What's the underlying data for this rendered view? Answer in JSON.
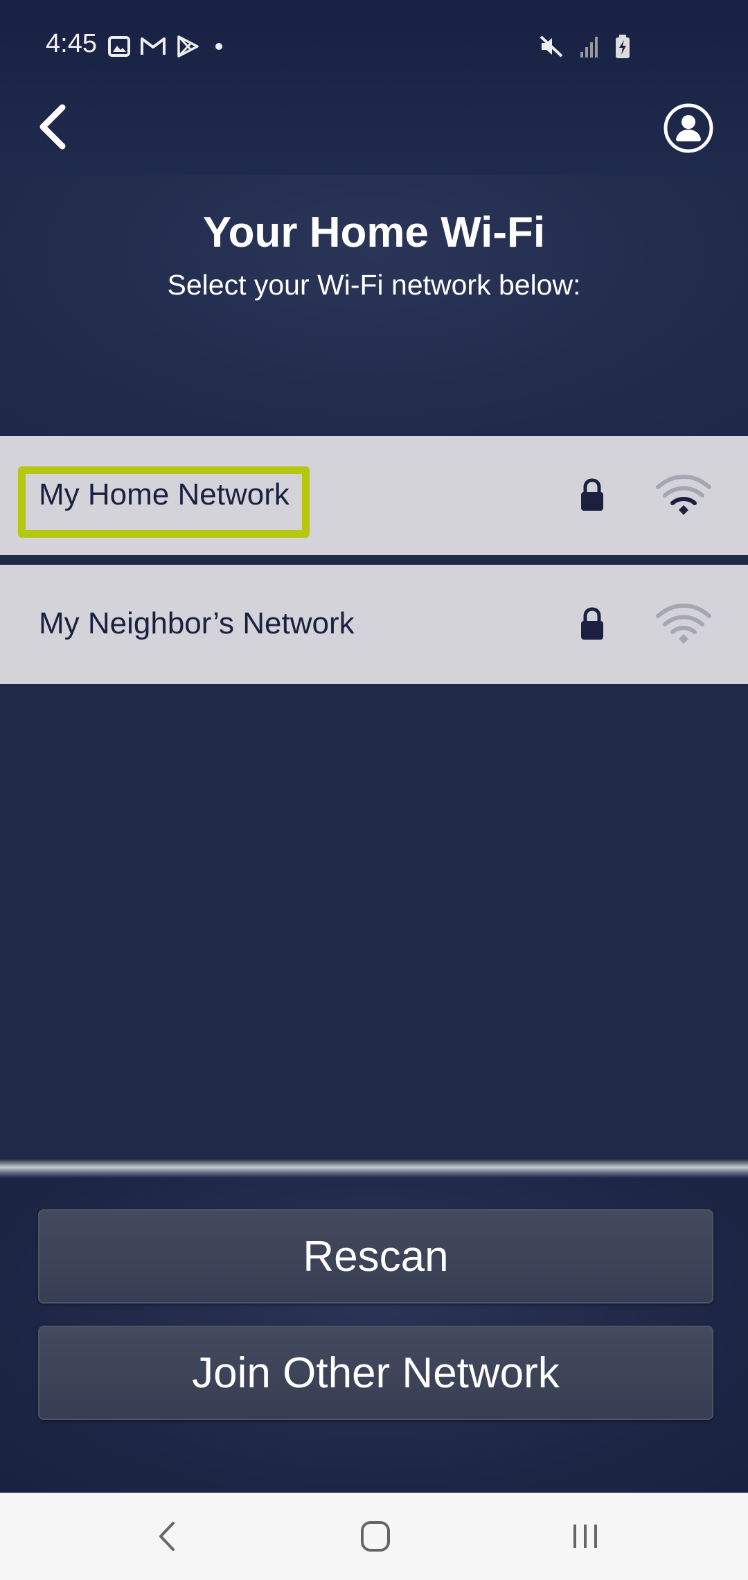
{
  "status_bar": {
    "time": "4:45",
    "left_icons": [
      "gallery-icon",
      "gmail-icon",
      "play-store-icon",
      "dot-icon"
    ],
    "right_icons": [
      "mute-icon",
      "signal-icon",
      "battery-charging-icon"
    ]
  },
  "app_bar": {
    "back_icon": "chevron-left-icon",
    "profile_icon": "account-circle-icon"
  },
  "header": {
    "title": "Your Home Wi-Fi",
    "subtitle": "Select your Wi-Fi network below:"
  },
  "networks": [
    {
      "name": "My Home Network",
      "secured": true,
      "signal_level": "full",
      "highlighted": true,
      "highlight_color": "#b5c70f"
    },
    {
      "name": "My Neighbor’s Network",
      "secured": true,
      "signal_level": "weak",
      "highlighted": false
    }
  ],
  "buttons": {
    "rescan": "Rescan",
    "join_other": "Join Other Network"
  },
  "nav_bar": {
    "icons": [
      "back-nav-icon",
      "home-nav-icon",
      "recents-nav-icon"
    ]
  },
  "colors": {
    "background": "#202947",
    "row": "#d3d3d9",
    "highlight": "#b5c70f",
    "button": "#3d4458"
  }
}
